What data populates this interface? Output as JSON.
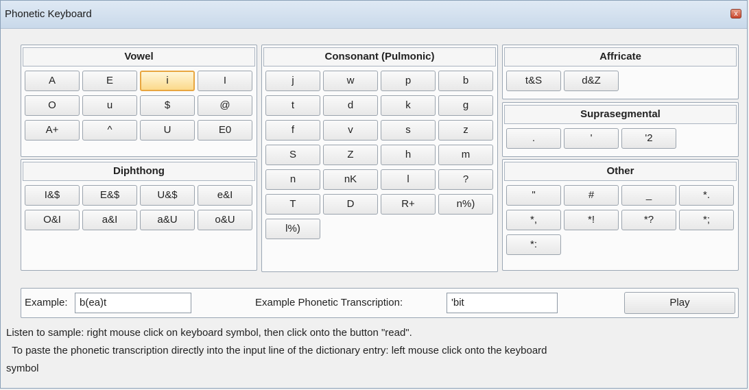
{
  "window": {
    "title": "Phonetic Keyboard",
    "close_glyph": "x"
  },
  "vowel": {
    "title": "Vowel",
    "keys": [
      [
        "A",
        "E",
        "i",
        "I"
      ],
      [
        "O",
        "u",
        "$",
        "@"
      ],
      [
        "A+",
        "^",
        "U",
        "E0"
      ]
    ],
    "selected": "i"
  },
  "diphthong": {
    "title": "Diphthong",
    "keys": [
      [
        "I&$",
        "E&$",
        "U&$",
        "e&I"
      ],
      [
        "O&I",
        "a&I",
        "a&U",
        "o&U"
      ]
    ]
  },
  "consonant": {
    "title": "Consonant (Pulmonic)",
    "keys": [
      [
        "j",
        "w",
        "p",
        "b"
      ],
      [
        "t",
        "d",
        "k",
        "g"
      ],
      [
        "f",
        "v",
        "s",
        "z"
      ],
      [
        "S",
        "Z",
        "h",
        "m"
      ],
      [
        "n",
        "nK",
        "l",
        "?"
      ],
      [
        "T",
        "D",
        "R+",
        "n%)"
      ],
      [
        "l%)"
      ]
    ]
  },
  "affricate": {
    "title": "Affricate",
    "keys": [
      [
        "t&S",
        "d&Z"
      ]
    ]
  },
  "suprasegmental": {
    "title": "Suprasegmental",
    "keys": [
      [
        ".",
        "'",
        "'2"
      ]
    ]
  },
  "other": {
    "title": "Other",
    "keys": [
      [
        "\"",
        "#",
        "_",
        "*."
      ],
      [
        "*,",
        "*!",
        "*?",
        "*;"
      ],
      [
        "*:"
      ]
    ]
  },
  "example": {
    "label": "Example:",
    "value": "b(ea)t",
    "transcription_label": "Example Phonetic Transcription:",
    "transcription_value": "'bit",
    "play_label": "Play"
  },
  "hints": {
    "line1": "Listen to sample: right mouse click on keyboard symbol, then click onto the button \"read\".",
    "line2": "  To paste the phonetic transcription directly into the input line of the dictionary entry: left mouse click onto the keyboard",
    "line3": "symbol"
  }
}
